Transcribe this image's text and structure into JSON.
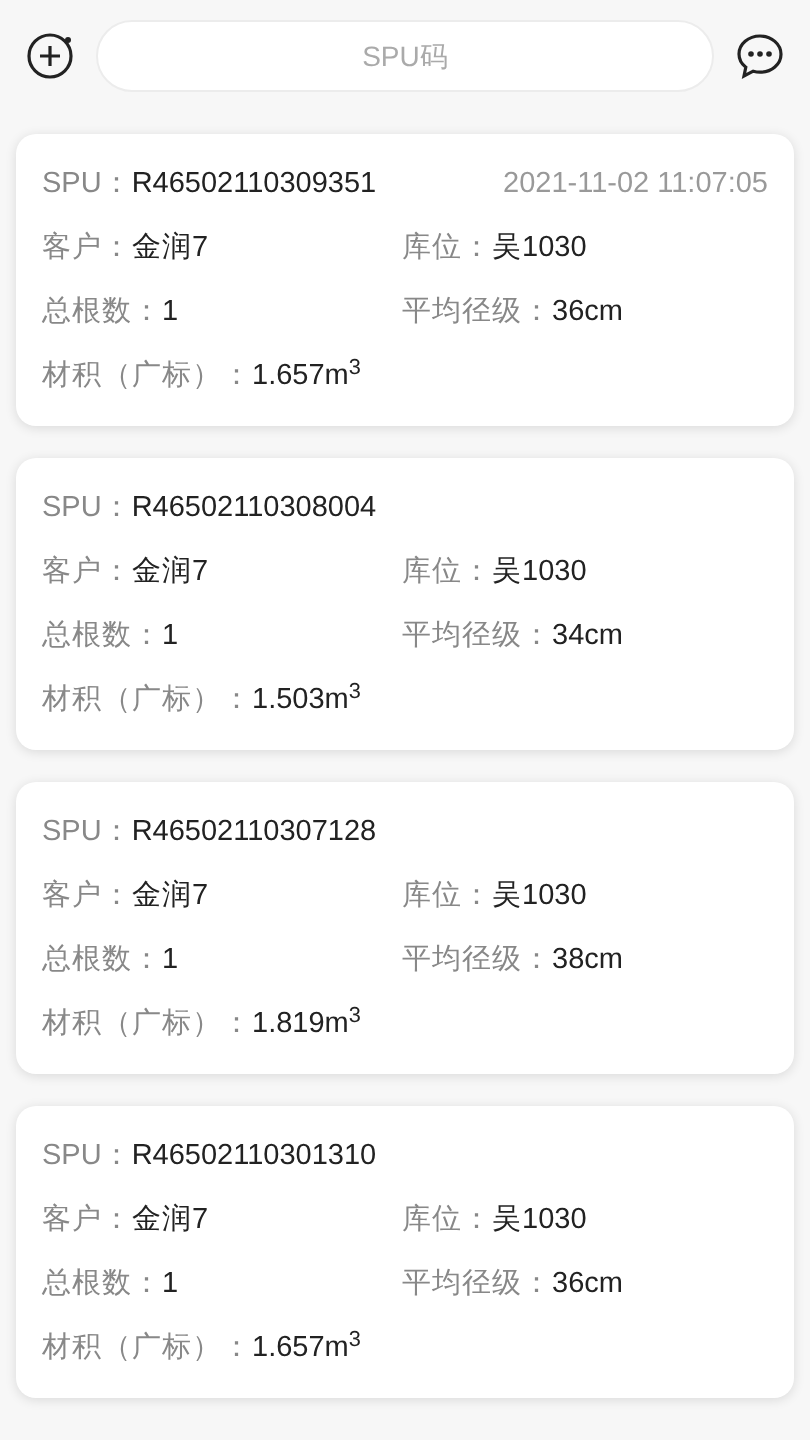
{
  "search": {
    "placeholder": "SPU码"
  },
  "records": [
    {
      "spu_label": "SPU：",
      "spu": "R46502110309351",
      "time": "2021-11-02 11:07:05",
      "customer_label": "客户：",
      "customer": "金润7",
      "location_label": "库位：",
      "location": "吴1030",
      "count_label": "总根数：",
      "count": "1",
      "diameter_label": "平均径级：",
      "diameter": "36cm",
      "volume_label": "材积（广标）：",
      "volume": "1.657m$^{3}$"
    },
    {
      "spu_label": "SPU：",
      "spu": "R46502110308004",
      "customer_label": "客户：",
      "customer": "金润7",
      "location_label": "库位：",
      "location": "吴1030",
      "count_label": "总根数：",
      "count": "1",
      "diameter_label": "平均径级：",
      "diameter": "34cm",
      "volume_label": "材积（广标）：",
      "volume": "1.503m$^{3}$"
    },
    {
      "spu_label": "SPU：",
      "spu": "R46502110307128",
      "customer_label": "客户：",
      "customer": "金润7",
      "location_label": "库位：",
      "location": "吴1030",
      "count_label": "总根数：",
      "count": "1",
      "diameter_label": "平均径级：",
      "diameter": "38cm",
      "volume_label": "材积（广标）：",
      "volume": "1.819m$^{3}$"
    },
    {
      "spu_label": "SPU：",
      "spu": "R46502110301310",
      "customer_label": "客户：",
      "customer": "金润7",
      "location_label": "库位：",
      "location": "吴1030",
      "count_label": "总根数：",
      "count": "1",
      "diameter_label": "平均径级：",
      "diameter": "36cm",
      "volume_label": "材积（广标）：",
      "volume": "1.657m$^{3}$"
    }
  ]
}
